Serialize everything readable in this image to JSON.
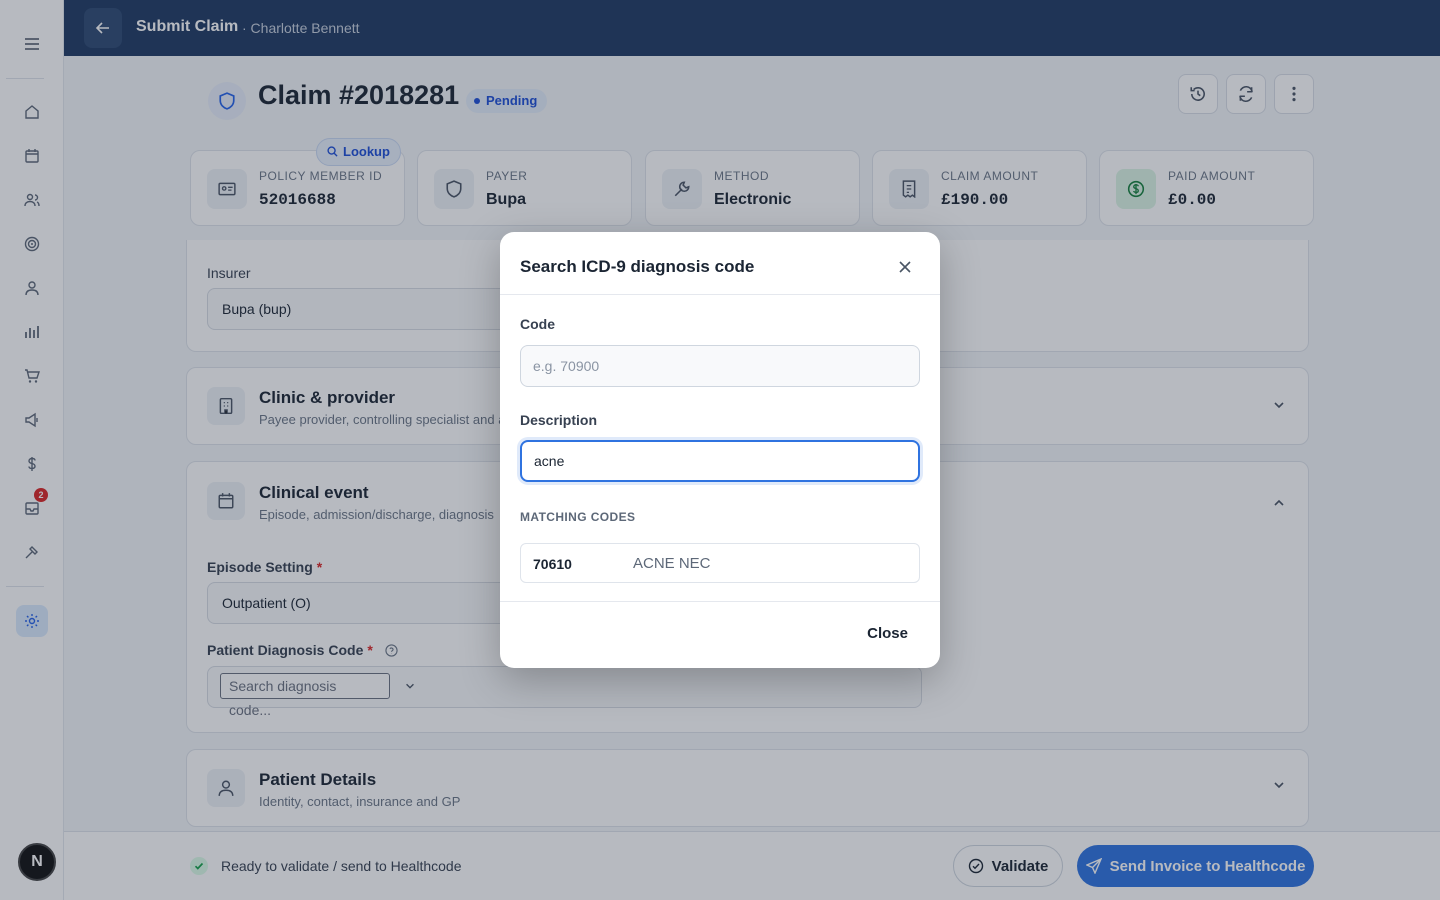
{
  "topbar": {
    "title": "Submit Claim",
    "subtitle": "· Charlotte Bennett"
  },
  "sidebar": {
    "items": [
      {
        "name": "home-icon"
      },
      {
        "name": "calendar-icon"
      },
      {
        "name": "users-icon"
      },
      {
        "name": "target-icon"
      },
      {
        "name": "user-icon"
      },
      {
        "name": "bar-chart-icon"
      },
      {
        "name": "cart-icon"
      },
      {
        "name": "megaphone-icon"
      },
      {
        "name": "dollar-icon"
      },
      {
        "name": "inbox-icon",
        "badge": "2"
      },
      {
        "name": "hammer-icon"
      },
      {
        "name": "settings-icon",
        "active": true
      }
    ],
    "avatar": "N"
  },
  "header": {
    "claim_title": "Claim #2018281",
    "status": "Pending"
  },
  "cards": [
    {
      "label": "POLICY MEMBER ID",
      "value": "52016688",
      "icon": "id-card-icon"
    },
    {
      "label": "PAYER",
      "value": "Bupa",
      "icon": "shield-icon"
    },
    {
      "label": "METHOD",
      "value": "Electronic",
      "icon": "wrench-icon"
    },
    {
      "label": "CLAIM AMOUNT",
      "value": "£190.00",
      "icon": "receipt-icon"
    },
    {
      "label": "PAID AMOUNT",
      "value": "£0.00",
      "icon": "dollar-circle-icon"
    }
  ],
  "lookup_label": "Lookup",
  "insurer": {
    "label": "Insurer",
    "value": "Bupa (bup)"
  },
  "sections": {
    "clinic": {
      "title": "Clinic & provider",
      "subtitle": "Payee provider, controlling specialist and au"
    },
    "clinical": {
      "title": "Clinical event",
      "subtitle": "Episode, admission/discharge, diagnosis",
      "episode_label": "Episode Setting",
      "episode_value": "Outpatient (O)",
      "diagnosis_label": "Patient Diagnosis Code",
      "diagnosis_placeholder": "Search diagnosis code..."
    },
    "patient": {
      "title": "Patient Details",
      "subtitle": "Identity, contact, insurance and GP"
    }
  },
  "bottombar": {
    "status_text": "Ready to validate / send to Healthcode",
    "validate_label": "Validate",
    "send_label": "Send Invoice to Healthcode"
  },
  "modal": {
    "title": "Search ICD-9 diagnosis code",
    "code_label": "Code",
    "code_placeholder": "e.g. 70900",
    "code_value": "",
    "description_label": "Description",
    "description_value": "acne",
    "matching_label": "MATCHING CODES",
    "results": [
      {
        "code": "70610",
        "description": "ACNE NEC"
      }
    ],
    "close_label": "Close"
  },
  "colors": {
    "topbar": "#1f3a63",
    "accent": "#2f73e0",
    "pending": "#1d4ed8",
    "danger": "#dc2626"
  }
}
